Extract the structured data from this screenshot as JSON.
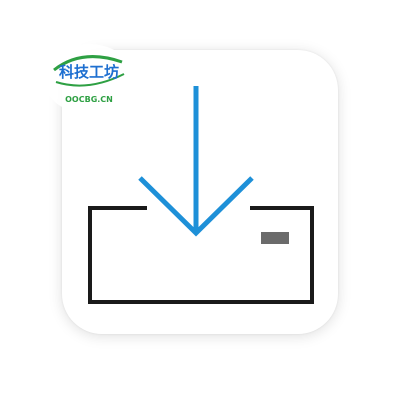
{
  "app_icon": {
    "icon_name": "download-to-tray-icon",
    "arrow_color": "#1e90d8",
    "tray_color": "#1a1a1a",
    "indicator_color": "#6b6b6b",
    "tile_color": "#ffffff"
  },
  "watermark": {
    "title": "科技工坊",
    "subtitle": "OOCBG.CN",
    "title_color": "#1e6fd0",
    "subtitle_color": "#2ea043"
  }
}
